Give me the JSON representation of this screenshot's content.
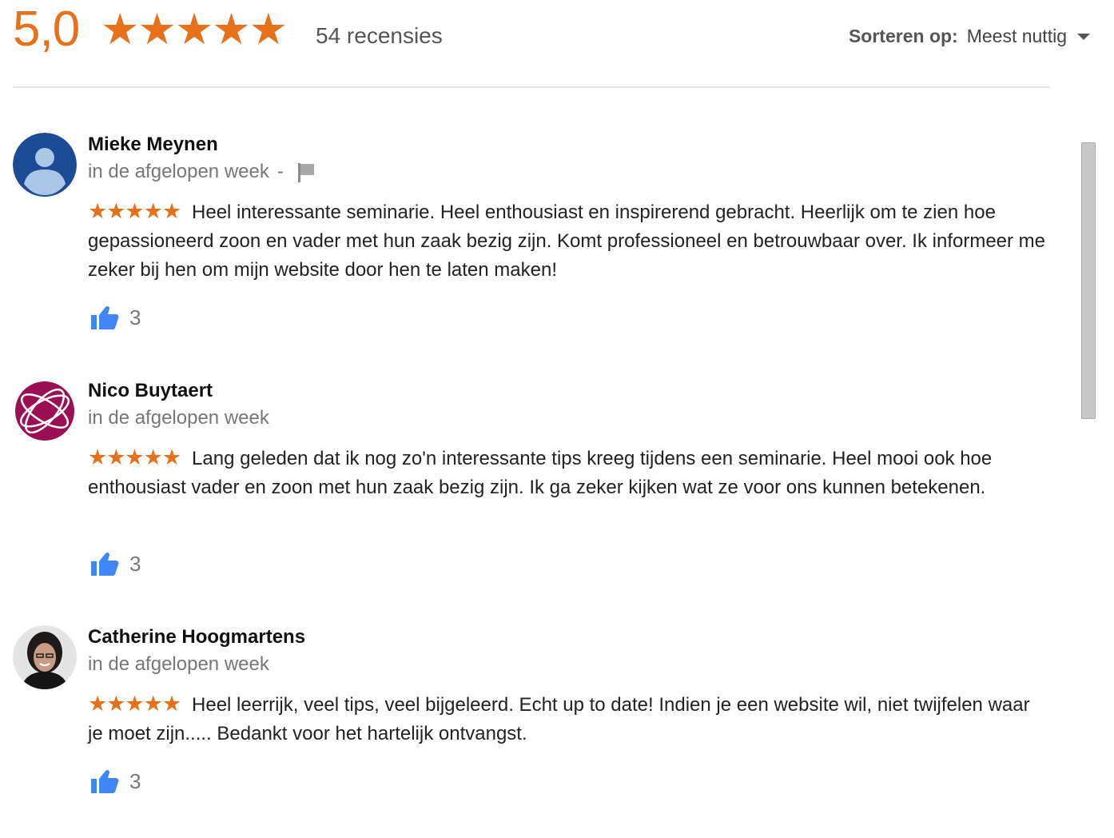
{
  "summary": {
    "score": "5,0",
    "stars": "★★★★★",
    "review_count": "54 recensies"
  },
  "sort": {
    "label": "Sorteren op:",
    "value": "Meest nuttig"
  },
  "colors": {
    "star": "#e7711b",
    "like": "#4285f4"
  },
  "reviews": [
    {
      "name": "Mieke Meynen",
      "time": "in de afgelopen week",
      "separator": "-",
      "rating": 5,
      "stars": "★★★★★",
      "text": "Heel interessante seminarie. Heel enthousiast en inspirerend gebracht. Heerlijk om te zien hoe gepassioneerd zoon en vader met hun zaak bezig zijn. Komt professioneel en betrouwbaar over. Ik informeer me zeker bij hen om mijn website door hen te laten maken!",
      "likes": "3",
      "avatar_icon": "default-person-avatar-icon",
      "flag_icon": "flag-icon"
    },
    {
      "name": "Nico Buytaert",
      "time": "in de afgelopen week",
      "rating": 5,
      "stars": "★★★★★",
      "text": "Lang geleden dat ik nog zo'n interessante tips kreeg tijdens een seminarie. Heel mooi ook hoe enthousiast vader en zoon met hun zaak bezig zijn. Ik ga zeker kijken wat ze voor ons kunnen betekenen.",
      "likes": "3",
      "avatar_icon": "globe-logo-avatar-icon"
    },
    {
      "name": "Catherine Hoogmartens",
      "time": "in de afgelopen week",
      "rating": 5,
      "stars": "★★★★★",
      "text": "Heel leerrijk, veel tips, veel bijgeleerd. Echt up to date! Indien je een website wil, niet twijfelen waar je moet zijn..... Bedankt voor het hartelijk ontvangst.",
      "likes": "3",
      "avatar_icon": "portrait-photo-avatar-icon"
    }
  ]
}
